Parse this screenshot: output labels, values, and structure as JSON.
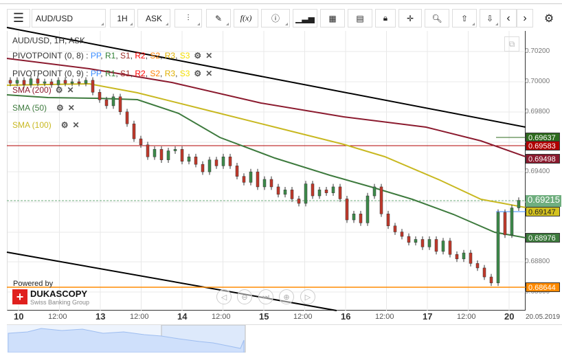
{
  "toolbar": {
    "menu": "menu-icon",
    "symbol": "AUD/USD",
    "period": "1H",
    "side": "ASK"
  },
  "legend": {
    "title": "AUD/USD, 1H, ASK",
    "pivots": [
      {
        "label": "PIVOTPOINT (0, 8)"
      },
      {
        "label": "PIVOTPOINT (0, 9)"
      }
    ],
    "pivot_parts": [
      {
        "t": "PP",
        "c": "#3b8cff"
      },
      {
        "t": "R1",
        "c": "#2e7d32"
      },
      {
        "t": "S1",
        "c": "#a0302a"
      },
      {
        "t": "R2",
        "c": "#ff0000"
      },
      {
        "t": "S2",
        "c": "#ff8000"
      },
      {
        "t": "R3",
        "c": "#e0b000"
      },
      {
        "t": "S3",
        "c": "#f5e000"
      }
    ],
    "smas": [
      {
        "label": "SMA (200)",
        "color": "#8b1a2e"
      },
      {
        "label": "SMA (50)",
        "color": "#3d7a3d"
      },
      {
        "label": "SMA (100)",
        "color": "#c8b820"
      }
    ]
  },
  "price_axis": [
    "0.70200",
    "0.70000",
    "0.69800",
    "0.69400",
    "0.68800",
    "0.68600"
  ],
  "price_tags": [
    {
      "v": "0.69637",
      "bg": "#2e6b1e"
    },
    {
      "v": "0.69583",
      "bg": "#b00000"
    },
    {
      "v": "0.69498",
      "bg": "#8b1a2e"
    },
    {
      "v": "0.69215",
      "bg": "#6fae7e"
    },
    {
      "v": "0.69147",
      "bg": "#d4c21e",
      "fg": "#222"
    },
    {
      "v": "0.68976",
      "bg": "#3d7a3d"
    },
    {
      "v": "0.68644",
      "bg": "#ff8a00"
    }
  ],
  "time_axis": [
    {
      "t": "10",
      "d": 1
    },
    {
      "t": "12:00"
    },
    {
      "t": "13",
      "d": 1
    },
    {
      "t": "12:00"
    },
    {
      "t": "14",
      "d": 1
    },
    {
      "t": "12:00"
    },
    {
      "t": "15",
      "d": 1
    },
    {
      "t": "12:00"
    },
    {
      "t": "16",
      "d": 1
    },
    {
      "t": "12:00"
    },
    {
      "t": "17",
      "d": 1
    },
    {
      "t": "12:00"
    },
    {
      "t": "20",
      "d": 1
    }
  ],
  "date_label": "20.05.2019",
  "branding": {
    "powered": "Powered by",
    "name": "DUKASCOPY",
    "sub": "Swiss Banking Group"
  },
  "closes": [
    0.6999,
    0.7001,
    0.6998,
    0.7002,
    0.6999,
    0.7,
    0.6998,
    0.7001,
    0.6999,
    0.7,
    0.6999,
    0.7001,
    0.6993,
    0.6988,
    0.6984,
    0.699,
    0.698,
    0.6972,
    0.6962,
    0.6958,
    0.695,
    0.6955,
    0.6948,
    0.6954,
    0.6955,
    0.6947,
    0.695,
    0.6945,
    0.694,
    0.6948,
    0.6944,
    0.695,
    0.6944,
    0.6937,
    0.6933,
    0.694,
    0.693,
    0.6935,
    0.693,
    0.6925,
    0.6928,
    0.6922,
    0.6919,
    0.6932,
    0.6924,
    0.6928,
    0.6926,
    0.693,
    0.6922,
    0.6908,
    0.6912,
    0.6906,
    0.6924,
    0.693,
    0.6912,
    0.6904,
    0.69,
    0.6897,
    0.6893,
    0.6895,
    0.689,
    0.6895,
    0.6887,
    0.6894,
    0.6885,
    0.6882,
    0.6886,
    0.6879,
    0.6876,
    0.687,
    0.6866,
    0.6913,
    0.6898,
    0.6916,
    0.6921
  ]
}
